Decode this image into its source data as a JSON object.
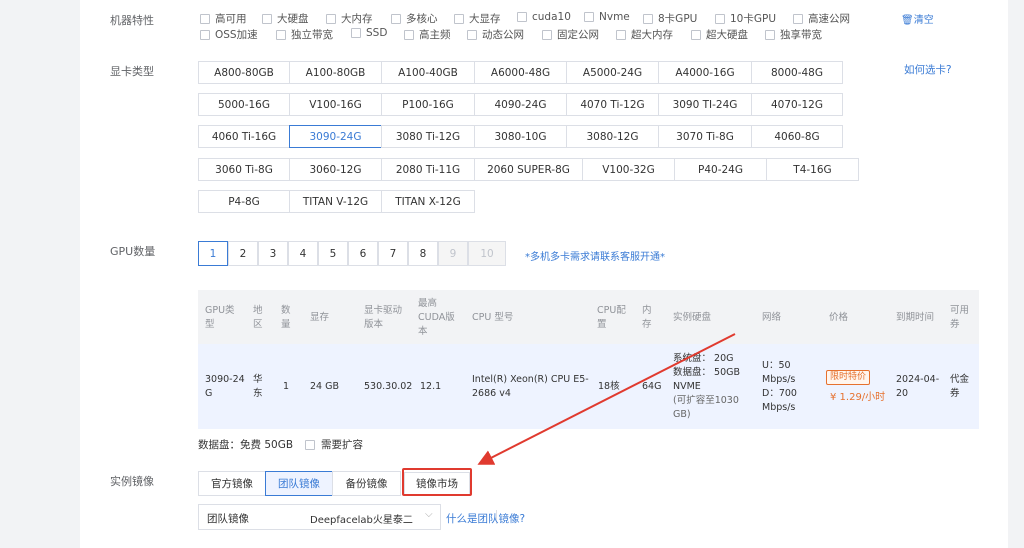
{
  "labels": {
    "features": "机器特性",
    "gpu_type": "显卡类型",
    "gpu_count": "GPU数量",
    "image": "实例镜像"
  },
  "features": {
    "row1": [
      "高可用",
      "大硬盘",
      "大内存",
      "多核心",
      "大显存",
      "cuda10",
      "Nvme",
      "8卡GPU",
      "10卡GPU",
      "高速公网"
    ],
    "row2": [
      "OSS加速",
      "独立带宽",
      "SSD",
      "高主频",
      "动态公网",
      "固定公网",
      "超大内存",
      "超大硬盘",
      "独享带宽"
    ],
    "clear": "清空"
  },
  "gpu_types": {
    "help_link": "如何选卡?",
    "rows": [
      [
        "A800-80GB",
        "A100-80GB",
        "A100-40GB",
        "A6000-48G",
        "A5000-24G",
        "A4000-16G",
        "8000-48G"
      ],
      [
        "5000-16G",
        "V100-16G",
        "P100-16G",
        "4090-24G",
        "4070 Ti-12G",
        "3090 TI-24G",
        "4070-12G"
      ],
      [
        "4060 Ti-16G",
        "3090-24G",
        "3080 Ti-12G",
        "3080-10G",
        "3080-12G",
        "3070 Ti-8G",
        "4060-8G"
      ],
      [
        "3060 Ti-8G",
        "3060-12G",
        "2080 Ti-11G",
        "2060 SUPER-8G",
        "V100-32G",
        "P40-24G",
        "T4-16G"
      ],
      [
        "P4-8G",
        "TITAN V-12G",
        "TITAN X-12G"
      ]
    ],
    "selected": "3090-24G"
  },
  "gpu_count": {
    "options": [
      "1",
      "2",
      "3",
      "4",
      "5",
      "6",
      "7",
      "8",
      "9",
      "10"
    ],
    "selected": "1",
    "disabled": [
      "9",
      "10"
    ],
    "note": "*多机多卡需求请联系客服开通*"
  },
  "table": {
    "headers": {
      "gpu_type": [
        "GPU类",
        "型"
      ],
      "region": [
        "地",
        "区"
      ],
      "count": [
        "数",
        "量"
      ],
      "vram": "显存",
      "driver": [
        "显卡驱动",
        "版本"
      ],
      "cuda": [
        "最高",
        "CUDA版",
        "本"
      ],
      "cpu_model": "CPU 型号",
      "cpu_cfg": [
        "CPU配",
        "置"
      ],
      "memory": [
        "内",
        "存"
      ],
      "disk": "实例硬盘",
      "network": "网络",
      "price": "价格",
      "expiry": "到期时间",
      "coupon": [
        "可用",
        "券"
      ]
    },
    "row": {
      "gpu_type": [
        "3090-24",
        "G"
      ],
      "region": [
        "华",
        "东"
      ],
      "count": "1",
      "vram": "24 GB",
      "driver": "530.30.02",
      "cuda": "12.1",
      "cpu_model": [
        "Intel(R) Xeon(R) CPU E5-",
        "2686 v4"
      ],
      "cpu_cfg": "18核",
      "memory": "64G",
      "disk": [
        "系统盘： 20G",
        "数据盘： 50GB",
        "NVME",
        "(可扩容至1030",
        "GB)"
      ],
      "network": [
        "U：50",
        "Mbps/s",
        "D：700",
        "Mbps/s"
      ],
      "price_badge": "限时特价",
      "price": "¥ 1.29/小时",
      "expiry": [
        "2024-04-",
        "20"
      ],
      "coupon": [
        "代金",
        "券"
      ]
    }
  },
  "data_disk": {
    "text": "数据盘：免费 50GB",
    "expand": "需要扩容"
  },
  "images": {
    "tabs": [
      "官方镜像",
      "团队镜像",
      "备份镜像",
      "镜像市场"
    ],
    "selected": "团队镜像",
    "select_category": "团队镜像",
    "select_value": "Deepfacelab火星泰二",
    "help_link": "什么是团队镜像?"
  },
  "colors": {
    "accent": "#3a7bd5",
    "highlight": "#e03a2f",
    "price": "#e6712e"
  }
}
